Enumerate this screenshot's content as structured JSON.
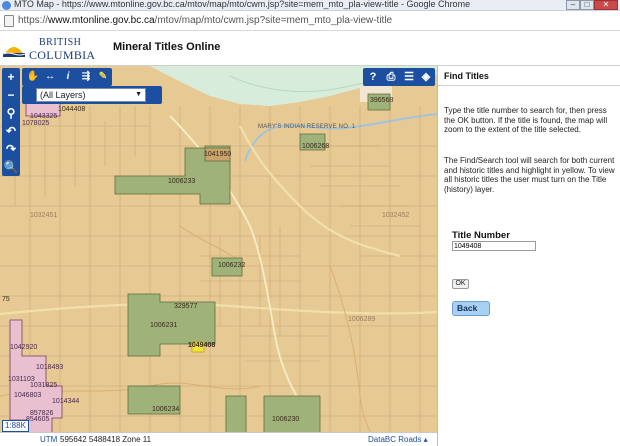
{
  "window": {
    "title": "MTO Map - https://www.mtonline.gov.bc.ca/mtov/map/mto/cwm.jsp?site=mem_mto_pla-view-title - Google Chrome",
    "minimize": "–",
    "maximize": "□",
    "close": "✕"
  },
  "address": {
    "scheme": "https://",
    "host": "www.mtonline.gov.bc.ca",
    "path": "/mtov/map/mto/cwm.jsp?site=mem_mto_pla-view-title"
  },
  "header": {
    "logo_line1": "BRITISH",
    "logo_line2": "COLUMBIA",
    "app_title": "Mineral Titles Online"
  },
  "map": {
    "layer_select": "(All Layers)",
    "tools_left": [
      "+",
      "✋",
      "↔",
      "i",
      "⇶",
      "✎"
    ],
    "tools_vertical": [
      "−",
      "⚲",
      "↶",
      "↷",
      "🔍"
    ],
    "tools_right": [
      "?",
      "⎙",
      "☰",
      "◈"
    ],
    "scale": "1:88K",
    "utm_label": "UTM",
    "coordinates": "595642 5488418 Zone 11",
    "basemap": "DataBC Roads ▴",
    "labels": {
      "t1044408": "1044408",
      "t1043325": "1043325",
      "t1078025": "1078025",
      "t1041950": "1041950",
      "t1006268": "1006268",
      "t1006233": "1006233",
      "t396568": "396568",
      "reserve": "MARY'S INDIAN RESERVE NO. 1",
      "t1006232": "1006232",
      "t329577": "329577",
      "t1006231": "1006231",
      "t1049408": "1049408",
      "t1042920": "1042920",
      "t1018493": "1018493",
      "t1031103": "1031103",
      "t1031825": "1031825",
      "t1014344": "1014344",
      "t1046803": "1046803",
      "t857826": "857826",
      "t854605": "854605",
      "t1006234": "1006234",
      "t1006230": "1006230",
      "t75": "75",
      "faint1": "1032451",
      "faint2": "1032452",
      "faint3": "1006289"
    }
  },
  "panel": {
    "title": "Find Titles",
    "para1": "Type the title number to search for, then press the OK button. If the title is found, the map will zoom to the extent of the title selected.",
    "para2": "The Find/Search tool will search for both current and historic titles and highlight in yellow. To view all historic titles the user must turn on the Title (history) layer.",
    "field_label": "Title Number",
    "title_value": "1049408",
    "ok_label": "OK",
    "back_label": "Back"
  }
}
